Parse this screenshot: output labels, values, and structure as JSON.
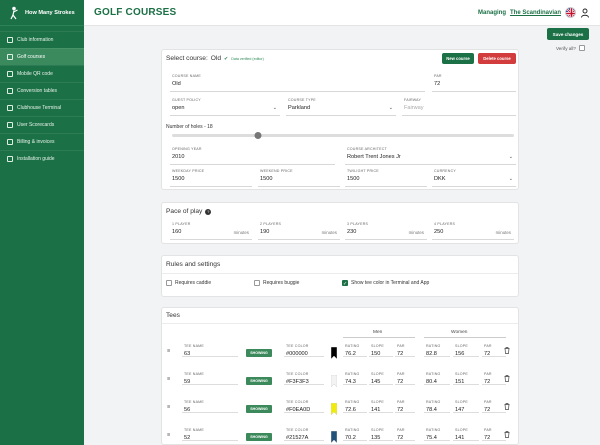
{
  "app": {
    "logo_text": "How Many Strokes"
  },
  "sidebar": {
    "items": [
      {
        "label": "Club information",
        "icon": "info-icon"
      },
      {
        "label": "Golf courses",
        "icon": "flag-icon",
        "active": true
      },
      {
        "label": "Mobile QR code",
        "icon": "phone-icon"
      },
      {
        "label": "Conversion tables",
        "icon": "table-icon"
      },
      {
        "label": "Clubhouse Terminal",
        "icon": "monitor-icon"
      },
      {
        "label": "User Scorecards",
        "icon": "scorecard-icon"
      },
      {
        "label": "Billing & invoices",
        "icon": "billing-icon"
      },
      {
        "label": "Installation guide",
        "icon": "help-icon"
      }
    ]
  },
  "header": {
    "title": "GOLF COURSES",
    "managing_label": "Managing",
    "club_name": "The Scandinavian"
  },
  "actions": {
    "save": "Save changes",
    "verify_all": "Verify all?"
  },
  "course": {
    "select_label": "Select course:",
    "selected": "Old",
    "verified": "Data verified (editor)",
    "new_course": "New course",
    "delete_course": "Delete course",
    "fields": {
      "course_name": {
        "label": "COURSE NAME",
        "value": "Old"
      },
      "par": {
        "label": "PAR",
        "value": "72"
      },
      "guest_policy": {
        "label": "GUEST POLICY",
        "value": "open"
      },
      "course_type": {
        "label": "COURSE TYPE",
        "value": "Parkland"
      },
      "fairway": {
        "label": "FAIRWAY",
        "value": "Fairway"
      },
      "opening_year": {
        "label": "OPENING YEAR",
        "value": "2010"
      },
      "architect": {
        "label": "COURSE ARCHITECT",
        "value": "Robert Trent Jones Jr"
      },
      "weekday_price": {
        "label": "WEEKDAY PRICE",
        "value": "1500"
      },
      "weekend_price": {
        "label": "WEEKEND PRICE",
        "value": "1500"
      },
      "twilight_price": {
        "label": "TWILIGHT PRICE",
        "value": "1500"
      },
      "currency": {
        "label": "CURRENCY",
        "value": "DKK"
      }
    },
    "holes_label": "Number of holes - 18",
    "holes_value": 18,
    "holes_range": [
      0,
      72
    ]
  },
  "pace": {
    "title": "Pace of play",
    "unit": "minutes",
    "players": [
      {
        "label": "1 PLAYER",
        "value": "160"
      },
      {
        "label": "2 PLAYERS",
        "value": "190"
      },
      {
        "label": "3 PLAYERS",
        "value": "230"
      },
      {
        "label": "4 PLAYERS",
        "value": "250"
      }
    ]
  },
  "rules": {
    "title": "Rules and settings",
    "options": [
      {
        "label": "Requires caddie",
        "checked": false
      },
      {
        "label": "Requires buggie",
        "checked": false
      },
      {
        "label": "Show tee color in Terminal and App",
        "checked": true
      }
    ]
  },
  "tees": {
    "title": "Tees",
    "groups": {
      "men": "Men",
      "women": "Women"
    },
    "labels": {
      "name": "TEE NAME",
      "color": "TEE COLOR",
      "rating": "RATING",
      "slope": "SLOPE",
      "par": "PAR"
    },
    "rows": [
      {
        "name": "63",
        "status": "SHOWING",
        "color": "#000000",
        "men": {
          "rating": "76.2",
          "slope": "150",
          "par": "72"
        },
        "women": {
          "rating": "82.8",
          "slope": "156",
          "par": "72"
        }
      },
      {
        "name": "59",
        "status": "SHOWING",
        "color": "#F3F3F3",
        "men": {
          "rating": "74.3",
          "slope": "145",
          "par": "72"
        },
        "women": {
          "rating": "80.4",
          "slope": "151",
          "par": "72"
        }
      },
      {
        "name": "56",
        "status": "SHOWING",
        "color": "#F0EA0D",
        "men": {
          "rating": "72.6",
          "slope": "141",
          "par": "72"
        },
        "women": {
          "rating": "78.4",
          "slope": "147",
          "par": "72"
        }
      },
      {
        "name": "52",
        "status": "SHOWING",
        "color": "#21527A",
        "men": {
          "rating": "70.2",
          "slope": "135",
          "par": "72"
        },
        "women": {
          "rating": "75.4",
          "slope": "141",
          "par": "72"
        }
      }
    ]
  },
  "colors": {
    "brand": "#1c7046",
    "danger": "#d23c3c",
    "checked": "#1c7046"
  }
}
